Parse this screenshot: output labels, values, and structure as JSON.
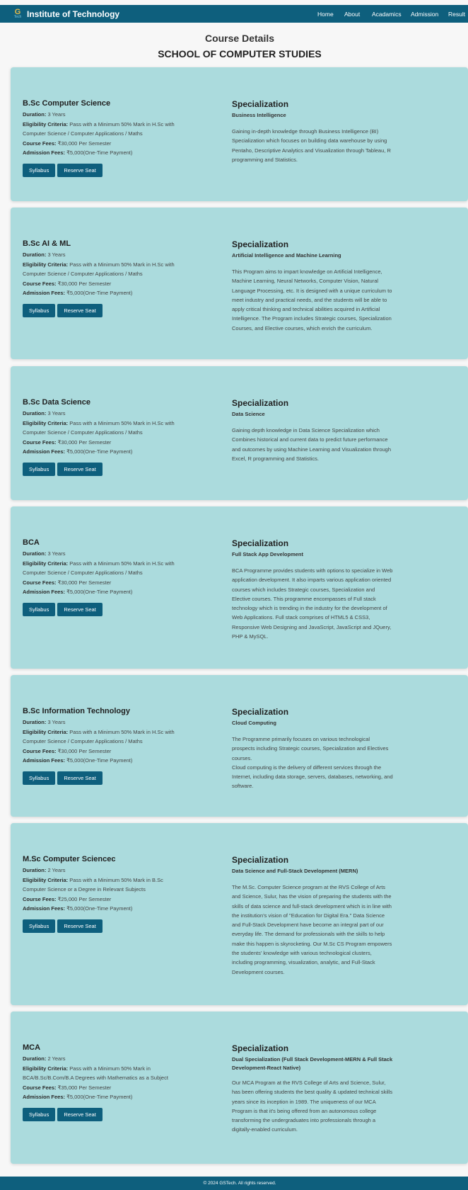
{
  "nav": {
    "logo_top": "G",
    "logo_bottom": "Tech",
    "brand": "Institute of Technology",
    "links": [
      "Home",
      "About",
      "Acadamics",
      "Admission",
      "Result"
    ]
  },
  "header": {
    "title": "Course Details",
    "school": "SCHOOL OF COMPUTER STUDIES"
  },
  "labels": {
    "duration": "Duration:",
    "eligibility": "Eligibility Criteria:",
    "fees": "Course Fees:",
    "admission": "Admission Fees:",
    "specialization": "Specialization",
    "syllabus": "Syllabus",
    "reserve": "Reserve Seat"
  },
  "courses": [
    {
      "name": "B.Sc Computer Science",
      "duration": "3 Years",
      "eligibility_lines": [
        "Pass with a Minimum 50% Mark in H.Sc with",
        "Computer Science / Computer Applications / Maths"
      ],
      "fees": "₹30,000 Per Semester",
      "admission": "₹5,000(One-Time Payment)",
      "specialization": "Business Intelligence",
      "description": [
        "Gaining in-depth knowledge through Business Intelligence (BI)",
        "Specialization which focuses on building data warehouse by using",
        "Pentaho, Descriptive Analytics and Visualization through Tableau, R",
        "programming and Statistics."
      ]
    },
    {
      "name": "B.Sc AI & ML",
      "duration": "3 Years",
      "eligibility_lines": [
        "Pass with a Minimum 50% Mark in H.Sc with",
        "Computer Science / Computer Applications / Maths"
      ],
      "fees": "₹30,000 Per Semester",
      "admission": "₹5,000(One-Time Payment)",
      "specialization": "Artificial Intelligence and Machine Learning",
      "description": [
        "This Program aims to impart knowledge on Artificial Intelligence,",
        "Machine Learning, Neural Networks, Computer Vision, Natural",
        "Language Processing, etc. It is designed with a unique curriculum to",
        "meet industry and practical needs, and the students will be able to",
        "apply critical thinking and technical abilities acquired in Artificial",
        "Intelligence. The Program includes Strategic courses, Specialization",
        "Courses, and Elective courses, which enrich the curriculum."
      ]
    },
    {
      "name": "B.Sc Data Science",
      "duration": "3 Years",
      "eligibility_lines": [
        "Pass with a Minimum 50% Mark in H.Sc with",
        "Computer Science / Computer Applications / Maths"
      ],
      "fees": "₹30,000 Per Semester",
      "admission": "₹5,000(One-Time Payment)",
      "specialization": "Data Science",
      "description": [
        "Gaining depth knowledge in Data Science Specialization which",
        "Combines historical and current data to predict future performance",
        "and outcomes by using Machine Learning and Visualization through",
        "Excel, R programming and Statistics."
      ]
    },
    {
      "name": "BCA",
      "duration": "3 Years",
      "eligibility_lines": [
        "Pass with a Minimum 50% Mark in H.Sc with",
        "Computer Science / Computer Applications / Maths"
      ],
      "fees": "₹30,000 Per Semester",
      "admission": "₹5,000(One-Time Payment)",
      "specialization": "Full Stack App Development",
      "description": [
        "BCA Programme provides students with options to specialize in Web",
        "application development. It also imparts various application oriented",
        "courses which includes Strategic courses, Specialization and",
        "Elective courses. This programme encompasses of Full stack",
        "technology which is trending in the industry for the development of",
        "Web Applications. Full stack comprises of HTML5 & CSS3,",
        "Responsive Web Designing and JavaScript, JavaScript and JQuery,",
        "PHP & MySQL."
      ]
    },
    {
      "name": "B.Sc Information Technology",
      "duration": "3 Years",
      "eligibility_lines": [
        "Pass with a Minimum 50% Mark in H.Sc with",
        "Computer Science / Computer Applications / Maths"
      ],
      "fees": "₹30,000 Per Semester",
      "admission": "₹5,000(One-Time Payment)",
      "specialization": "Cloud Computing",
      "description": [
        "The Programme primarily focuses on various technological",
        "prospects including Strategic courses, Specialization and Electives",
        "courses.",
        "Cloud computing is the delivery of different services through the",
        "Internet, including data storage, servers, databases, networking, and",
        "software."
      ]
    },
    {
      "name": "M.Sc Computer Sciencec",
      "duration": "2 Years",
      "eligibility_lines": [
        "Pass with a Minimum 50% Mark in B.Sc",
        "Computer Science or a Degree in Relevant Subjects"
      ],
      "fees": "₹25,000 Per Semester",
      "admission": "₹5,000(One-Time Payment)",
      "specialization": "Data Science and Full-Stack Development (MERN)",
      "description": [
        "The M.Sc. Computer Science program at the RVS College of Arts",
        "and Science, Sulur, has the vision of preparing the students with the",
        "skills of data science and full-stack development which is in line with",
        "the institution's vision of \"Education for Digital Era.\" Data Science",
        "and Full-Stack Development have become an integral part of our",
        "everyday life. The demand for professionals with the skills to help",
        "make this happen is skyrocketing. Our M.Sc CS Program empowers",
        "the students' knowledge with various technological clusters,",
        "including programming, visualization, analytic, and Full-Stack",
        "Development courses."
      ]
    },
    {
      "name": "MCA",
      "duration": "2 Years",
      "eligibility_lines": [
        "Pass with a Minimum 50% Mark in",
        "BCA/B.Sc/B.Com/B.A Degrees with Mathematics as a Subject"
      ],
      "fees": "₹35,000 Per Semester",
      "admission": "₹5,000(One-Time Payment)",
      "specialization_lines": [
        "Dual Specialization (Full Stack Development-MERN & Full Stack",
        "Development-React Native)"
      ],
      "description": [
        "Our MCA Program at the RVS College of Arts and Science, Sulur,",
        "has been offering students the best quality & updated technical skills",
        "years since its inception in 1989. The uniqueness of our MCA",
        "Program is that it's being offered from an autonomous college",
        "transforming the undergraduates into professionals through a",
        "digitally-enabled curriculum."
      ]
    }
  ],
  "footer": {
    "text": "© 2024 GSTech. All rights reserved."
  },
  "colors": {
    "primary": "#0e5f7d",
    "card": "#abdbdd",
    "background": "#f7f7f7"
  }
}
